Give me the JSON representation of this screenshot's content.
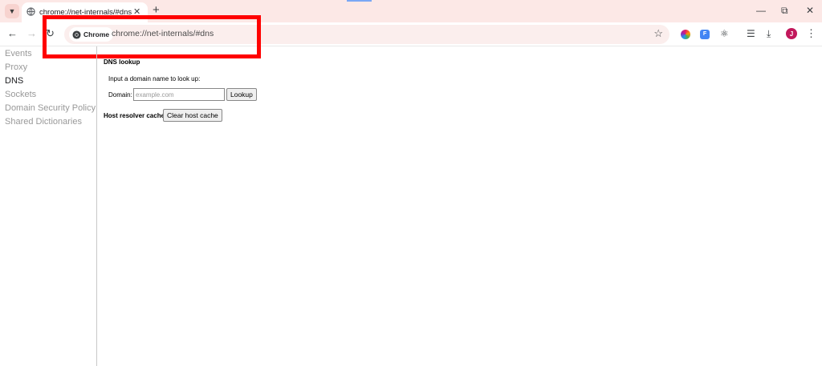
{
  "browser": {
    "tab": {
      "title": "chrome://net-internals/#dns",
      "favicon": "globe-icon"
    },
    "omnibox": {
      "chip_label": "Chrome",
      "url": "chrome://net-internals/#dns"
    },
    "profile_initial": "J",
    "colors": {
      "tabstrip_bg": "#fce8e6",
      "omnibox_bg": "#fbeeed",
      "highlight_box": "#ff0000",
      "avatar": "#c2185b"
    }
  },
  "sidebar": {
    "items": [
      {
        "label": "Events"
      },
      {
        "label": "Proxy"
      },
      {
        "label": "DNS",
        "active": true
      },
      {
        "label": "Sockets"
      },
      {
        "label": "Domain Security Policy"
      },
      {
        "label": "Shared Dictionaries"
      }
    ]
  },
  "dns": {
    "lookup_title": "DNS lookup",
    "lookup_description": "Input a domain name to look up:",
    "domain_label": "Domain:",
    "domain_placeholder": "example.com",
    "domain_value": "",
    "lookup_button": "Lookup",
    "cache_title": "Host resolver cache",
    "clear_cache_button": "Clear host cache"
  }
}
